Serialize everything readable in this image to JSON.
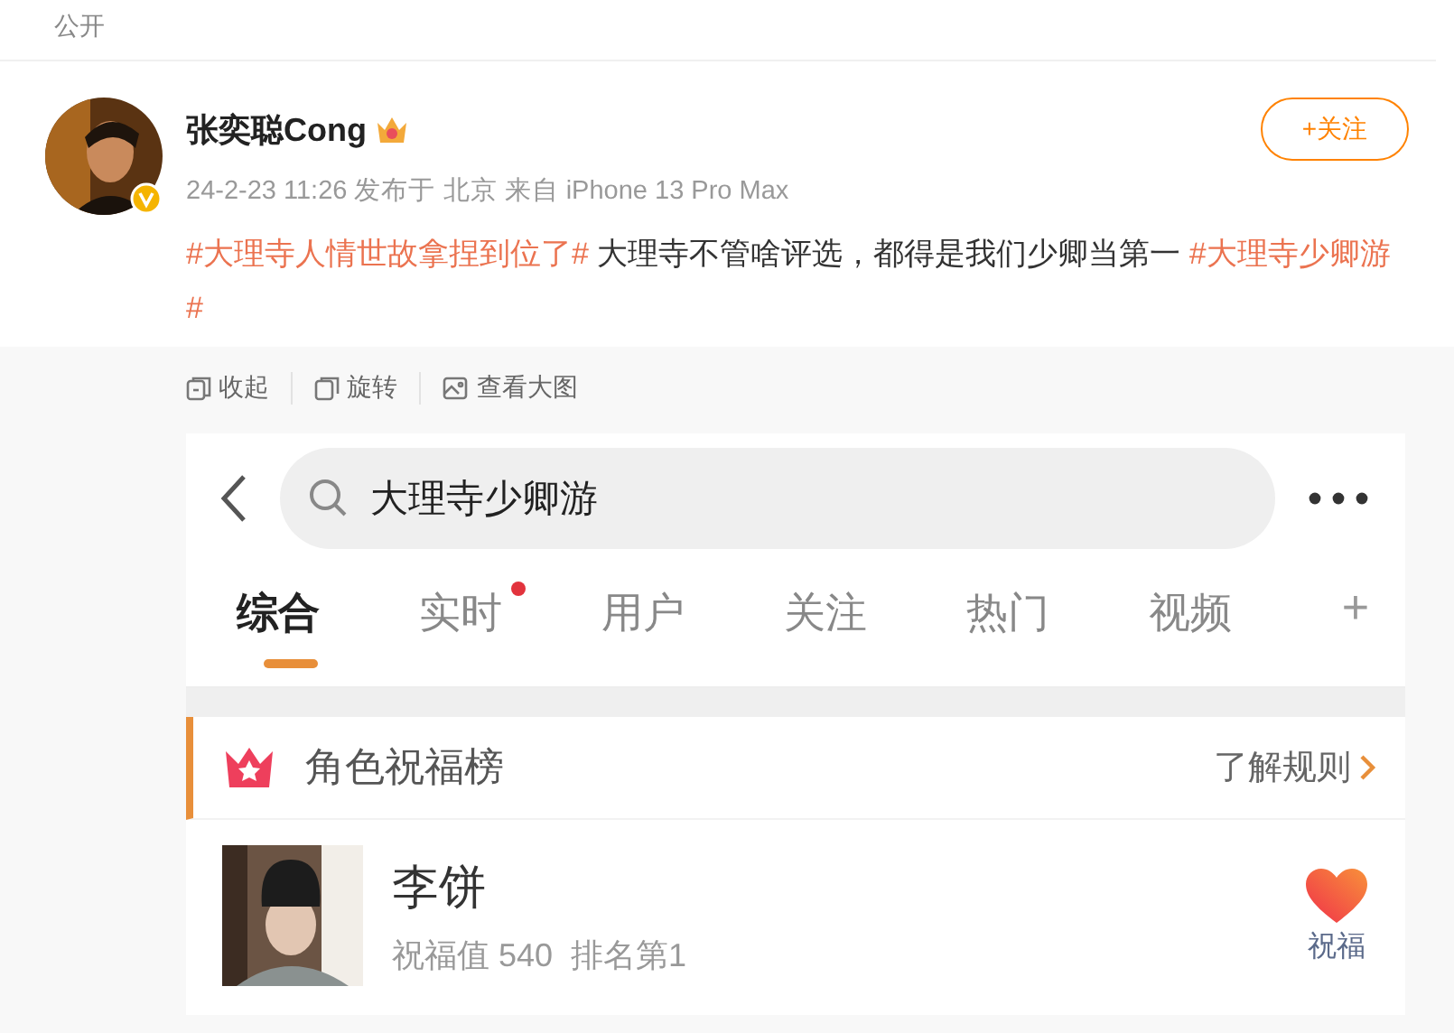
{
  "visibility": "公开",
  "post": {
    "author": "张奕聪Cong",
    "verified": true,
    "meta": "24-2-23 11:26 发布于 北京 来自 iPhone 13 Pro Max",
    "follow_button": "+关注",
    "content": [
      {
        "kind": "hashtag",
        "text": "#大理寺人情世故拿捏到位了#"
      },
      {
        "kind": "text",
        "text": " 大理寺不管啥评选，都得是我们少卿当第一 "
      },
      {
        "kind": "hashtag",
        "text": "#大理寺少卿游#"
      }
    ]
  },
  "image_actions": [
    {
      "kind": "collapse",
      "label": "收起"
    },
    {
      "kind": "rotate",
      "label": "旋转"
    },
    {
      "kind": "view",
      "label": "查看大图"
    }
  ],
  "screenshot": {
    "search": {
      "value": "大理寺少卿游"
    },
    "tabs": [
      {
        "label": "综合",
        "selected": true,
        "dot": false
      },
      {
        "label": "实时",
        "selected": false,
        "dot": true
      },
      {
        "label": "用户",
        "selected": false,
        "dot": false
      },
      {
        "label": "关注",
        "selected": false,
        "dot": false
      },
      {
        "label": "热门",
        "selected": false,
        "dot": false
      },
      {
        "label": "视频",
        "selected": false,
        "dot": false
      }
    ],
    "add_tab": "+",
    "section": {
      "title": "角色祝福榜",
      "link": "了解规则"
    },
    "entry": {
      "name": "李饼",
      "stats": "祝福值 540  排名第1",
      "action": "祝福"
    }
  }
}
